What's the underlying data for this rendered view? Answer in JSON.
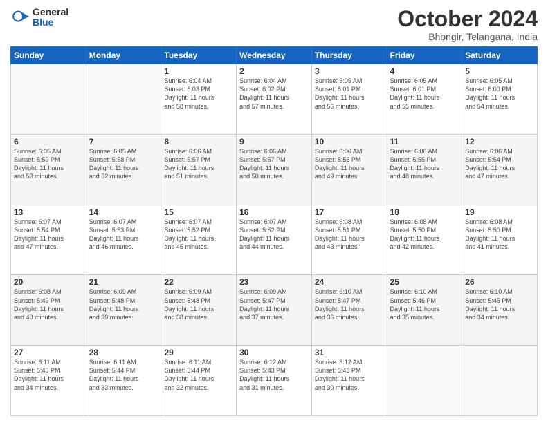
{
  "logo": {
    "general": "General",
    "blue": "Blue"
  },
  "title": "October 2024",
  "subtitle": "Bhongir, Telangana, India",
  "header_days": [
    "Sunday",
    "Monday",
    "Tuesday",
    "Wednesday",
    "Thursday",
    "Friday",
    "Saturday"
  ],
  "weeks": [
    [
      {
        "day": "",
        "info": ""
      },
      {
        "day": "",
        "info": ""
      },
      {
        "day": "1",
        "info": "Sunrise: 6:04 AM\nSunset: 6:03 PM\nDaylight: 11 hours\nand 58 minutes."
      },
      {
        "day": "2",
        "info": "Sunrise: 6:04 AM\nSunset: 6:02 PM\nDaylight: 11 hours\nand 57 minutes."
      },
      {
        "day": "3",
        "info": "Sunrise: 6:05 AM\nSunset: 6:01 PM\nDaylight: 11 hours\nand 56 minutes."
      },
      {
        "day": "4",
        "info": "Sunrise: 6:05 AM\nSunset: 6:01 PM\nDaylight: 11 hours\nand 55 minutes."
      },
      {
        "day": "5",
        "info": "Sunrise: 6:05 AM\nSunset: 6:00 PM\nDaylight: 11 hours\nand 54 minutes."
      }
    ],
    [
      {
        "day": "6",
        "info": "Sunrise: 6:05 AM\nSunset: 5:59 PM\nDaylight: 11 hours\nand 53 minutes."
      },
      {
        "day": "7",
        "info": "Sunrise: 6:05 AM\nSunset: 5:58 PM\nDaylight: 11 hours\nand 52 minutes."
      },
      {
        "day": "8",
        "info": "Sunrise: 6:06 AM\nSunset: 5:57 PM\nDaylight: 11 hours\nand 51 minutes."
      },
      {
        "day": "9",
        "info": "Sunrise: 6:06 AM\nSunset: 5:57 PM\nDaylight: 11 hours\nand 50 minutes."
      },
      {
        "day": "10",
        "info": "Sunrise: 6:06 AM\nSunset: 5:56 PM\nDaylight: 11 hours\nand 49 minutes."
      },
      {
        "day": "11",
        "info": "Sunrise: 6:06 AM\nSunset: 5:55 PM\nDaylight: 11 hours\nand 48 minutes."
      },
      {
        "day": "12",
        "info": "Sunrise: 6:06 AM\nSunset: 5:54 PM\nDaylight: 11 hours\nand 47 minutes."
      }
    ],
    [
      {
        "day": "13",
        "info": "Sunrise: 6:07 AM\nSunset: 5:54 PM\nDaylight: 11 hours\nand 47 minutes."
      },
      {
        "day": "14",
        "info": "Sunrise: 6:07 AM\nSunset: 5:53 PM\nDaylight: 11 hours\nand 46 minutes."
      },
      {
        "day": "15",
        "info": "Sunrise: 6:07 AM\nSunset: 5:52 PM\nDaylight: 11 hours\nand 45 minutes."
      },
      {
        "day": "16",
        "info": "Sunrise: 6:07 AM\nSunset: 5:52 PM\nDaylight: 11 hours\nand 44 minutes."
      },
      {
        "day": "17",
        "info": "Sunrise: 6:08 AM\nSunset: 5:51 PM\nDaylight: 11 hours\nand 43 minutes."
      },
      {
        "day": "18",
        "info": "Sunrise: 6:08 AM\nSunset: 5:50 PM\nDaylight: 11 hours\nand 42 minutes."
      },
      {
        "day": "19",
        "info": "Sunrise: 6:08 AM\nSunset: 5:50 PM\nDaylight: 11 hours\nand 41 minutes."
      }
    ],
    [
      {
        "day": "20",
        "info": "Sunrise: 6:08 AM\nSunset: 5:49 PM\nDaylight: 11 hours\nand 40 minutes."
      },
      {
        "day": "21",
        "info": "Sunrise: 6:09 AM\nSunset: 5:48 PM\nDaylight: 11 hours\nand 39 minutes."
      },
      {
        "day": "22",
        "info": "Sunrise: 6:09 AM\nSunset: 5:48 PM\nDaylight: 11 hours\nand 38 minutes."
      },
      {
        "day": "23",
        "info": "Sunrise: 6:09 AM\nSunset: 5:47 PM\nDaylight: 11 hours\nand 37 minutes."
      },
      {
        "day": "24",
        "info": "Sunrise: 6:10 AM\nSunset: 5:47 PM\nDaylight: 11 hours\nand 36 minutes."
      },
      {
        "day": "25",
        "info": "Sunrise: 6:10 AM\nSunset: 5:46 PM\nDaylight: 11 hours\nand 35 minutes."
      },
      {
        "day": "26",
        "info": "Sunrise: 6:10 AM\nSunset: 5:45 PM\nDaylight: 11 hours\nand 34 minutes."
      }
    ],
    [
      {
        "day": "27",
        "info": "Sunrise: 6:11 AM\nSunset: 5:45 PM\nDaylight: 11 hours\nand 34 minutes."
      },
      {
        "day": "28",
        "info": "Sunrise: 6:11 AM\nSunset: 5:44 PM\nDaylight: 11 hours\nand 33 minutes."
      },
      {
        "day": "29",
        "info": "Sunrise: 6:11 AM\nSunset: 5:44 PM\nDaylight: 11 hours\nand 32 minutes."
      },
      {
        "day": "30",
        "info": "Sunrise: 6:12 AM\nSunset: 5:43 PM\nDaylight: 11 hours\nand 31 minutes."
      },
      {
        "day": "31",
        "info": "Sunrise: 6:12 AM\nSunset: 5:43 PM\nDaylight: 11 hours\nand 30 minutes."
      },
      {
        "day": "",
        "info": ""
      },
      {
        "day": "",
        "info": ""
      }
    ]
  ]
}
